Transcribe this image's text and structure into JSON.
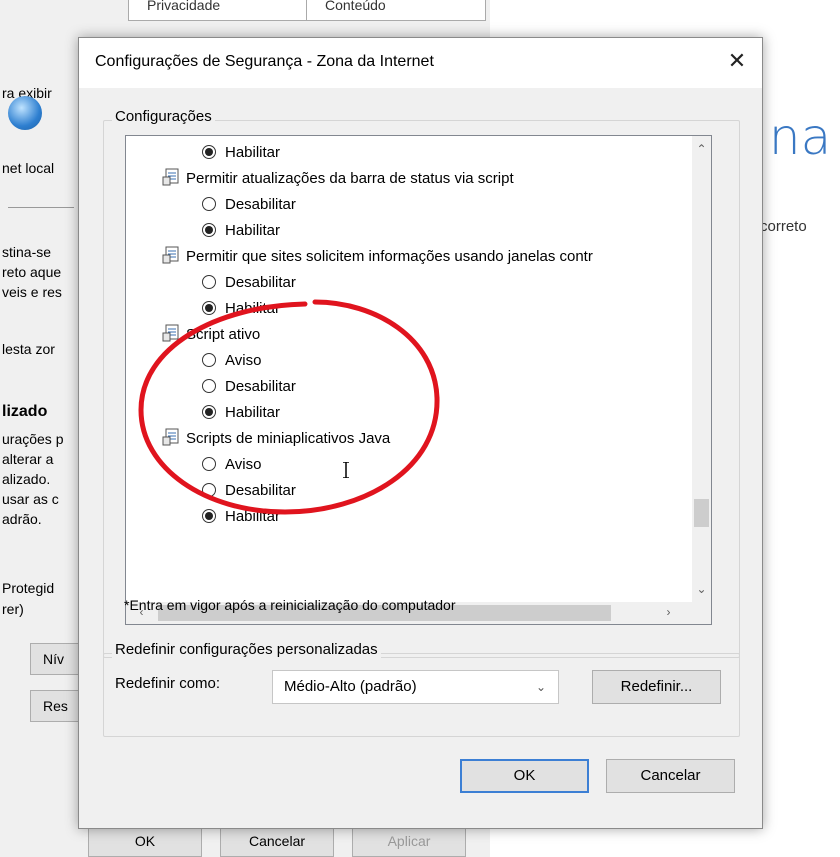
{
  "background": {
    "tabs": [
      "Privacidade",
      "Conteúdo"
    ],
    "left_texts": [
      "ra exibir",
      "net local",
      "stina-se",
      "reto aque",
      "veis e res",
      "lesta zor",
      "lizado",
      "urações p",
      "alterar a",
      "alizado.",
      "usar as c",
      "adrão.",
      "Protegid",
      "rer)"
    ],
    "buttons": [
      "Nív",
      "Res"
    ],
    "bottom_buttons": [
      "OK",
      "Cancelar",
      "Aplicar"
    ],
    "right_heading": "ina",
    "right_text": "correto"
  },
  "dialog": {
    "title": "Configurações de Segurança - Zona da Internet",
    "close_glyph": "✕",
    "settings_group_label": "Configurações",
    "tree_rows": [
      {
        "kind": "option",
        "label": "Habilitar",
        "checked": true
      },
      {
        "kind": "setting",
        "label": "Permitir atualizações da barra de status via script"
      },
      {
        "kind": "option",
        "label": "Desabilitar",
        "checked": false
      },
      {
        "kind": "option",
        "label": "Habilitar",
        "checked": true
      },
      {
        "kind": "setting",
        "label": "Permitir que sites solicitem informações usando janelas contr"
      },
      {
        "kind": "option",
        "label": "Desabilitar",
        "checked": false
      },
      {
        "kind": "option",
        "label": "Habilitar",
        "checked": true
      },
      {
        "kind": "setting",
        "label": "Script ativo"
      },
      {
        "kind": "option",
        "label": "Aviso",
        "checked": false
      },
      {
        "kind": "option",
        "label": "Desabilitar",
        "checked": false
      },
      {
        "kind": "option",
        "label": "Habilitar",
        "checked": true
      },
      {
        "kind": "setting",
        "label": "Scripts de miniaplicativos Java"
      },
      {
        "kind": "option",
        "label": "Aviso",
        "checked": false
      },
      {
        "kind": "option",
        "label": "Desabilitar",
        "checked": false
      },
      {
        "kind": "option",
        "label": "Habilitar",
        "checked": true
      }
    ],
    "restart_note": "*Entra em vigor após a reinicialização do computador",
    "reset_group_label": "Redefinir configurações personalizadas",
    "reset_as_label": "Redefinir como:",
    "reset_select_value": "Médio-Alto (padrão)",
    "reset_button": "Redefinir...",
    "ok_button": "OK",
    "cancel_button": "Cancelar"
  },
  "colors": {
    "annotation_ellipse": "#e0141e",
    "default_button_border": "#3c7fd4",
    "dialog_bg": "#f0f0f0"
  }
}
